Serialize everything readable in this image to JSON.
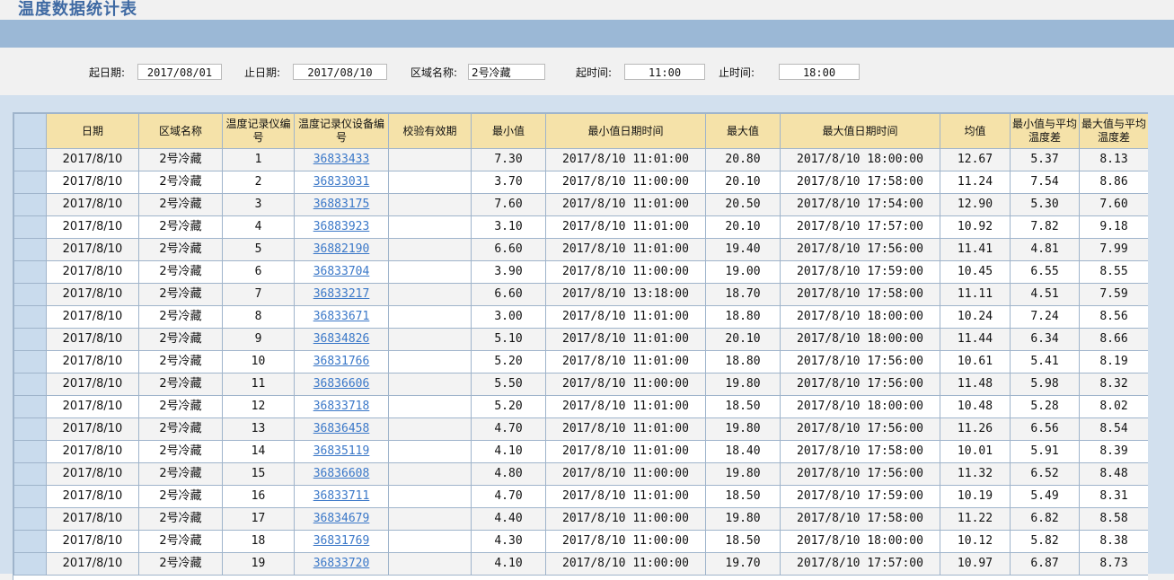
{
  "page": {
    "title": "温度数据统计表"
  },
  "filters": {
    "start_date_label": "起日期:",
    "start_date_value": "2017/08/01",
    "end_date_label": "止日期:",
    "end_date_value": "2017/08/10",
    "area_label": "区域名称:",
    "area_value": "2号冷藏",
    "start_time_label": "起时间:",
    "start_time_value": "11:00",
    "end_time_label": "止时间:",
    "end_time_value": "18:00"
  },
  "table": {
    "headers": [
      "日期",
      "区域名称",
      "温度记录仪编号",
      "温度记录仪设备编号",
      "校验有效期",
      "最小值",
      "最小值日期时间",
      "最大值",
      "最大值日期时间",
      "均值",
      "最小值与平均温度差",
      "最大值与平均温度差"
    ],
    "rows": [
      {
        "date": "2017/8/10",
        "area": "2号冷藏",
        "recorder_no": "1",
        "device_no": "36833433",
        "valid": "",
        "min": "7.30",
        "min_time": "2017/8/10 11:01:00",
        "max": "20.80",
        "max_time": "2017/8/10 18:00:00",
        "avg": "12.67",
        "min_diff": "5.37",
        "max_diff": "8.13"
      },
      {
        "date": "2017/8/10",
        "area": "2号冷藏",
        "recorder_no": "2",
        "device_no": "36833031",
        "valid": "",
        "min": "3.70",
        "min_time": "2017/8/10 11:00:00",
        "max": "20.10",
        "max_time": "2017/8/10 17:58:00",
        "avg": "11.24",
        "min_diff": "7.54",
        "max_diff": "8.86"
      },
      {
        "date": "2017/8/10",
        "area": "2号冷藏",
        "recorder_no": "3",
        "device_no": "36883175",
        "valid": "",
        "min": "7.60",
        "min_time": "2017/8/10 11:01:00",
        "max": "20.50",
        "max_time": "2017/8/10 17:54:00",
        "avg": "12.90",
        "min_diff": "5.30",
        "max_diff": "7.60"
      },
      {
        "date": "2017/8/10",
        "area": "2号冷藏",
        "recorder_no": "4",
        "device_no": "36883923",
        "valid": "",
        "min": "3.10",
        "min_time": "2017/8/10 11:01:00",
        "max": "20.10",
        "max_time": "2017/8/10 17:57:00",
        "avg": "10.92",
        "min_diff": "7.82",
        "max_diff": "9.18"
      },
      {
        "date": "2017/8/10",
        "area": "2号冷藏",
        "recorder_no": "5",
        "device_no": "36882190",
        "valid": "",
        "min": "6.60",
        "min_time": "2017/8/10 11:01:00",
        "max": "19.40",
        "max_time": "2017/8/10 17:56:00",
        "avg": "11.41",
        "min_diff": "4.81",
        "max_diff": "7.99"
      },
      {
        "date": "2017/8/10",
        "area": "2号冷藏",
        "recorder_no": "6",
        "device_no": "36833704",
        "valid": "",
        "min": "3.90",
        "min_time": "2017/8/10 11:00:00",
        "max": "19.00",
        "max_time": "2017/8/10 17:59:00",
        "avg": "10.45",
        "min_diff": "6.55",
        "max_diff": "8.55"
      },
      {
        "date": "2017/8/10",
        "area": "2号冷藏",
        "recorder_no": "7",
        "device_no": "36833217",
        "valid": "",
        "min": "6.60",
        "min_time": "2017/8/10 13:18:00",
        "max": "18.70",
        "max_time": "2017/8/10 17:58:00",
        "avg": "11.11",
        "min_diff": "4.51",
        "max_diff": "7.59"
      },
      {
        "date": "2017/8/10",
        "area": "2号冷藏",
        "recorder_no": "8",
        "device_no": "36833671",
        "valid": "",
        "min": "3.00",
        "min_time": "2017/8/10 11:01:00",
        "max": "18.80",
        "max_time": "2017/8/10 18:00:00",
        "avg": "10.24",
        "min_diff": "7.24",
        "max_diff": "8.56"
      },
      {
        "date": "2017/8/10",
        "area": "2号冷藏",
        "recorder_no": "9",
        "device_no": "36834826",
        "valid": "",
        "min": "5.10",
        "min_time": "2017/8/10 11:01:00",
        "max": "20.10",
        "max_time": "2017/8/10 18:00:00",
        "avg": "11.44",
        "min_diff": "6.34",
        "max_diff": "8.66"
      },
      {
        "date": "2017/8/10",
        "area": "2号冷藏",
        "recorder_no": "10",
        "device_no": "36831766",
        "valid": "",
        "min": "5.20",
        "min_time": "2017/8/10 11:01:00",
        "max": "18.80",
        "max_time": "2017/8/10 17:56:00",
        "avg": "10.61",
        "min_diff": "5.41",
        "max_diff": "8.19"
      },
      {
        "date": "2017/8/10",
        "area": "2号冷藏",
        "recorder_no": "11",
        "device_no": "36836606",
        "valid": "",
        "min": "5.50",
        "min_time": "2017/8/10 11:00:00",
        "max": "19.80",
        "max_time": "2017/8/10 17:56:00",
        "avg": "11.48",
        "min_diff": "5.98",
        "max_diff": "8.32"
      },
      {
        "date": "2017/8/10",
        "area": "2号冷藏",
        "recorder_no": "12",
        "device_no": "36833718",
        "valid": "",
        "min": "5.20",
        "min_time": "2017/8/10 11:01:00",
        "max": "18.50",
        "max_time": "2017/8/10 18:00:00",
        "avg": "10.48",
        "min_diff": "5.28",
        "max_diff": "8.02"
      },
      {
        "date": "2017/8/10",
        "area": "2号冷藏",
        "recorder_no": "13",
        "device_no": "36836458",
        "valid": "",
        "min": "4.70",
        "min_time": "2017/8/10 11:01:00",
        "max": "19.80",
        "max_time": "2017/8/10 17:56:00",
        "avg": "11.26",
        "min_diff": "6.56",
        "max_diff": "8.54"
      },
      {
        "date": "2017/8/10",
        "area": "2号冷藏",
        "recorder_no": "14",
        "device_no": "36835119",
        "valid": "",
        "min": "4.10",
        "min_time": "2017/8/10 11:01:00",
        "max": "18.40",
        "max_time": "2017/8/10 17:58:00",
        "avg": "10.01",
        "min_diff": "5.91",
        "max_diff": "8.39"
      },
      {
        "date": "2017/8/10",
        "area": "2号冷藏",
        "recorder_no": "15",
        "device_no": "36836608",
        "valid": "",
        "min": "4.80",
        "min_time": "2017/8/10 11:00:00",
        "max": "19.80",
        "max_time": "2017/8/10 17:56:00",
        "avg": "11.32",
        "min_diff": "6.52",
        "max_diff": "8.48"
      },
      {
        "date": "2017/8/10",
        "area": "2号冷藏",
        "recorder_no": "16",
        "device_no": "36833711",
        "valid": "",
        "min": "4.70",
        "min_time": "2017/8/10 11:01:00",
        "max": "18.50",
        "max_time": "2017/8/10 17:59:00",
        "avg": "10.19",
        "min_diff": "5.49",
        "max_diff": "8.31"
      },
      {
        "date": "2017/8/10",
        "area": "2号冷藏",
        "recorder_no": "17",
        "device_no": "36834679",
        "valid": "",
        "min": "4.40",
        "min_time": "2017/8/10 11:00:00",
        "max": "19.80",
        "max_time": "2017/8/10 17:58:00",
        "avg": "11.22",
        "min_diff": "6.82",
        "max_diff": "8.58"
      },
      {
        "date": "2017/8/10",
        "area": "2号冷藏",
        "recorder_no": "18",
        "device_no": "36831769",
        "valid": "",
        "min": "4.30",
        "min_time": "2017/8/10 11:00:00",
        "max": "18.50",
        "max_time": "2017/8/10 18:00:00",
        "avg": "10.12",
        "min_diff": "5.82",
        "max_diff": "8.38"
      },
      {
        "date": "2017/8/10",
        "area": "2号冷藏",
        "recorder_no": "19",
        "device_no": "36833720",
        "valid": "",
        "min": "4.10",
        "min_time": "2017/8/10 11:00:00",
        "max": "19.70",
        "max_time": "2017/8/10 17:57:00",
        "avg": "10.97",
        "min_diff": "6.87",
        "max_diff": "8.73"
      }
    ]
  },
  "colors": {
    "title": "#3f6aa3",
    "title_bar": "#9bb8d6",
    "header_bg": "#f5e2a9",
    "row_header_bg": "#c9dbed",
    "link": "#3b78c8"
  }
}
